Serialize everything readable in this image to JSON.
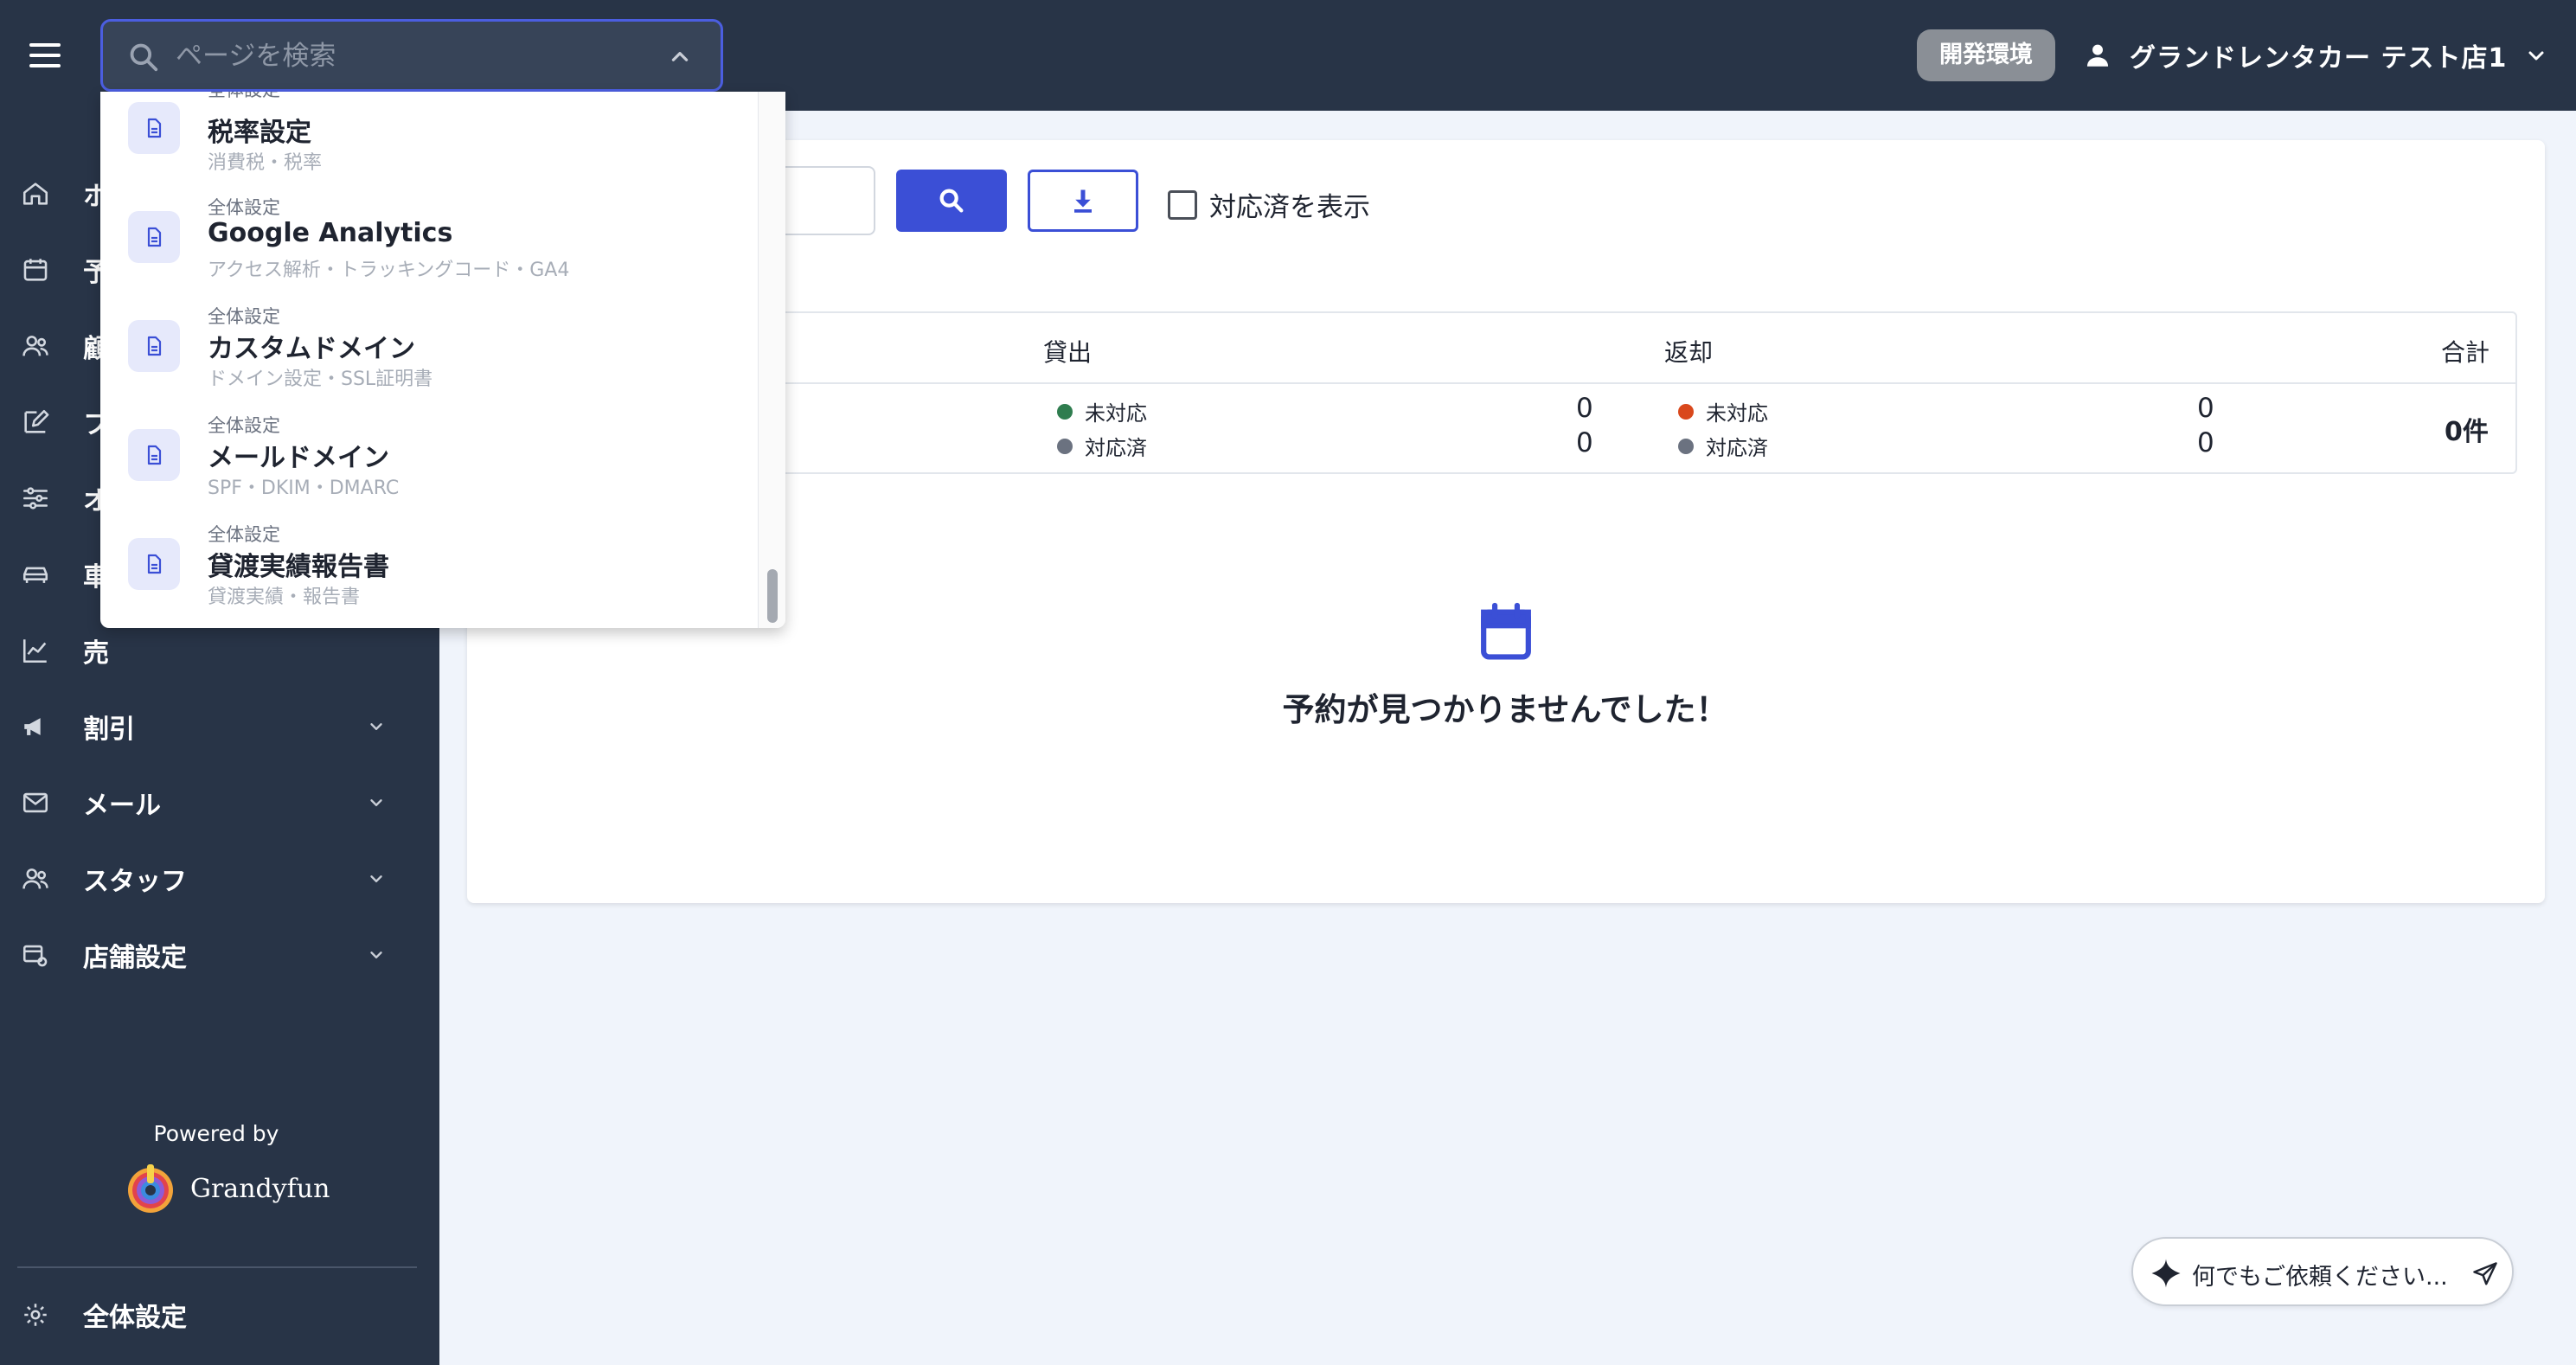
{
  "header": {
    "search_placeholder": "ページを検索",
    "env_badge": "開発環境",
    "user_name": "グランドレンタカー テスト店1"
  },
  "sidebar": {
    "items": [
      {
        "label": "ホ",
        "icon": "home-icon"
      },
      {
        "label": "予",
        "icon": "calendar-icon"
      },
      {
        "label": "顧",
        "icon": "users-icon"
      },
      {
        "label": "フ",
        "icon": "edit-icon"
      },
      {
        "label": "オ",
        "icon": "sliders-icon"
      },
      {
        "label": "車",
        "icon": "car-icon"
      },
      {
        "label": "売",
        "icon": "chart-icon"
      },
      {
        "label": "割引",
        "icon": "megaphone-icon"
      },
      {
        "label": "メール",
        "icon": "mail-icon"
      },
      {
        "label": "スタッフ",
        "icon": "staff-icon"
      },
      {
        "label": "店舗設定",
        "icon": "store-settings-icon"
      }
    ],
    "powered_by": "Powered by",
    "brand_name": "Grandyfun",
    "footer_item": "全体設定"
  },
  "toolbar": {
    "show_handled_label": "対応済を表示"
  },
  "table": {
    "headers": {
      "lend": "貸出",
      "return": "返却",
      "total": "合計"
    },
    "lend": {
      "pending_label": "未対応",
      "pending_count": "0",
      "done_label": "対応済",
      "done_count": "0"
    },
    "return": {
      "pending_label": "未対応",
      "pending_count": "0",
      "done_label": "対応済",
      "done_count": "0"
    },
    "total_value": "0件"
  },
  "empty_state": {
    "message": "予約が見つかりませんでした！"
  },
  "dropdown": {
    "partial_top_category": "全体設定",
    "results": [
      {
        "category": "全体設定",
        "title": "税率設定",
        "keywords": "消費税・税率"
      },
      {
        "category": "全体設定",
        "title": "Google Analytics",
        "keywords": "アクセス解析・トラッキングコード・GA4"
      },
      {
        "category": "全体設定",
        "title": "カスタムドメイン",
        "keywords": "ドメイン設定・SSL証明書"
      },
      {
        "category": "全体設定",
        "title": "メールドメイン",
        "keywords": "SPF・DKIM・DMARC"
      },
      {
        "category": "全体設定",
        "title": "貸渡実績報告書",
        "keywords": "貸渡実績・報告書"
      }
    ]
  },
  "ai_assistant": {
    "placeholder": "何でもご依頼ください..."
  },
  "colors": {
    "header_bg": "#283447",
    "accent": "#3b4fd6",
    "page_bg": "#f0f4fb",
    "lend_pending_dot": "#2f7d4f",
    "return_pending_dot": "#d9481c",
    "done_dot": "#6b7280"
  }
}
